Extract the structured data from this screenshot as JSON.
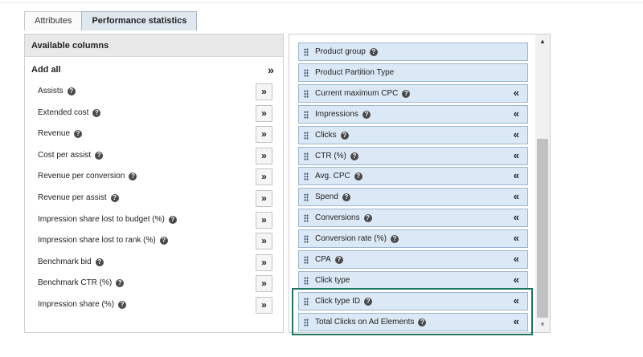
{
  "tabs": [
    {
      "label": "Attributes",
      "active": false
    },
    {
      "label": "Performance statistics",
      "active": true
    }
  ],
  "available": {
    "header": "Available columns",
    "add_all_label": "Add all",
    "add_all_icon": "»",
    "add_icon": "»",
    "items": [
      {
        "label": "Assists"
      },
      {
        "label": "Extended cost"
      },
      {
        "label": "Revenue"
      },
      {
        "label": "Cost per assist"
      },
      {
        "label": "Revenue per conversion"
      },
      {
        "label": "Revenue per assist"
      },
      {
        "label": "Impression share lost to budget (%)"
      },
      {
        "label": "Impression share lost to rank (%)"
      },
      {
        "label": "Benchmark bid"
      },
      {
        "label": "Benchmark CTR (%)"
      },
      {
        "label": "Impression share (%)"
      }
    ]
  },
  "selected": {
    "remove_icon": "«",
    "items": [
      {
        "label": "Product group",
        "help": true,
        "removable": false
      },
      {
        "label": "Product Partition Type",
        "help": false,
        "removable": false
      },
      {
        "label": "Current maximum CPC",
        "help": true,
        "removable": true
      },
      {
        "label": "Impressions",
        "help": true,
        "removable": true
      },
      {
        "label": "Clicks",
        "help": true,
        "removable": true
      },
      {
        "label": "CTR (%)",
        "help": true,
        "removable": true
      },
      {
        "label": "Avg. CPC",
        "help": true,
        "removable": true
      },
      {
        "label": "Spend",
        "help": true,
        "removable": true
      },
      {
        "label": "Conversions",
        "help": true,
        "removable": true
      },
      {
        "label": "Conversion rate (%)",
        "help": true,
        "removable": true
      },
      {
        "label": "CPA",
        "help": true,
        "removable": true
      },
      {
        "label": "Click type",
        "help": false,
        "removable": true
      },
      {
        "label": "Click type ID",
        "help": true,
        "removable": true
      },
      {
        "label": "Total Clicks on Ad Elements",
        "help": true,
        "removable": true
      }
    ]
  },
  "help_glyph": "?",
  "scrollbar": {
    "up_icon": "▲",
    "down_icon": "▼"
  },
  "colors": {
    "item_bg": "#dbe8f6",
    "item_border": "#9db5cd",
    "highlight": "#1d7464",
    "active_tab": "#dfe7ef"
  }
}
